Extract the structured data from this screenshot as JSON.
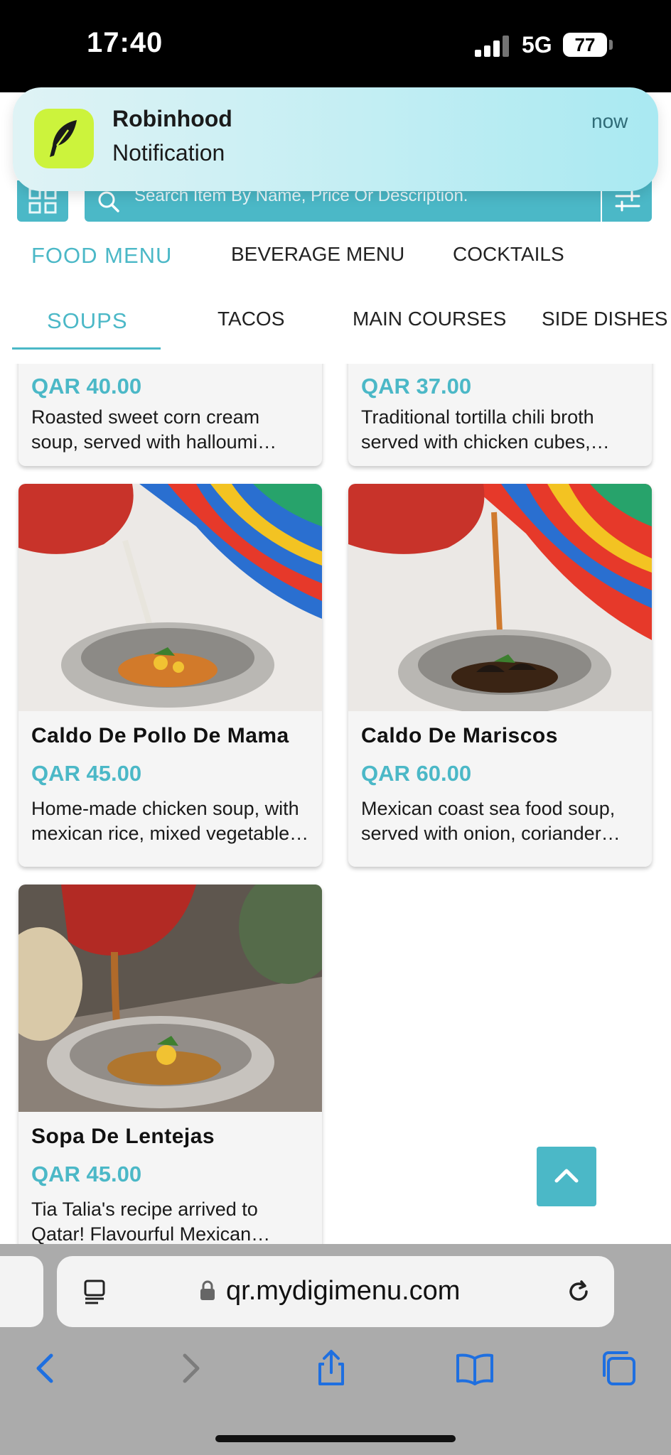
{
  "status_bar": {
    "time": "17:40",
    "network": "5G",
    "battery": "77"
  },
  "notification": {
    "app": "Robinhood",
    "body": "Notification",
    "time": "now"
  },
  "search": {
    "placeholder": "Search Item By Name, Price Or Description."
  },
  "menu_tabs": [
    "FOOD MENU",
    "BEVERAGE MENU",
    "COCKTAILS"
  ],
  "category_tabs": [
    "SOUPS",
    "TACOS",
    "MAIN COURSES",
    "SIDE DISHES"
  ],
  "items": [
    {
      "price": "QAR 40.00",
      "desc1": "Roasted sweet corn cream",
      "desc2": "soup, served with halloumi…"
    },
    {
      "price": "QAR 37.00",
      "desc1": "Traditional tortilla chili broth",
      "desc2": "served with chicken cubes,…"
    },
    {
      "name": "Caldo De Pollo De Mama",
      "price": "QAR 45.00",
      "desc1": "Home-made chicken soup, with",
      "desc2": "mexican rice, mixed vegetable…"
    },
    {
      "name": "Caldo De Mariscos",
      "price": "QAR 60.00",
      "desc1": "Mexican coast sea food soup,",
      "desc2": "served with onion, coriander…"
    },
    {
      "name": "Sopa De Lentejas",
      "price": "QAR 45.00",
      "desc1": "Tia Talia's recipe arrived to",
      "desc2": "Qatar! Flavourful Mexican…"
    }
  ],
  "browser": {
    "url": "qr.mydigimenu.com"
  },
  "colors": {
    "accent": "#4bb8c7",
    "notification_icon": "#ccf33c"
  }
}
